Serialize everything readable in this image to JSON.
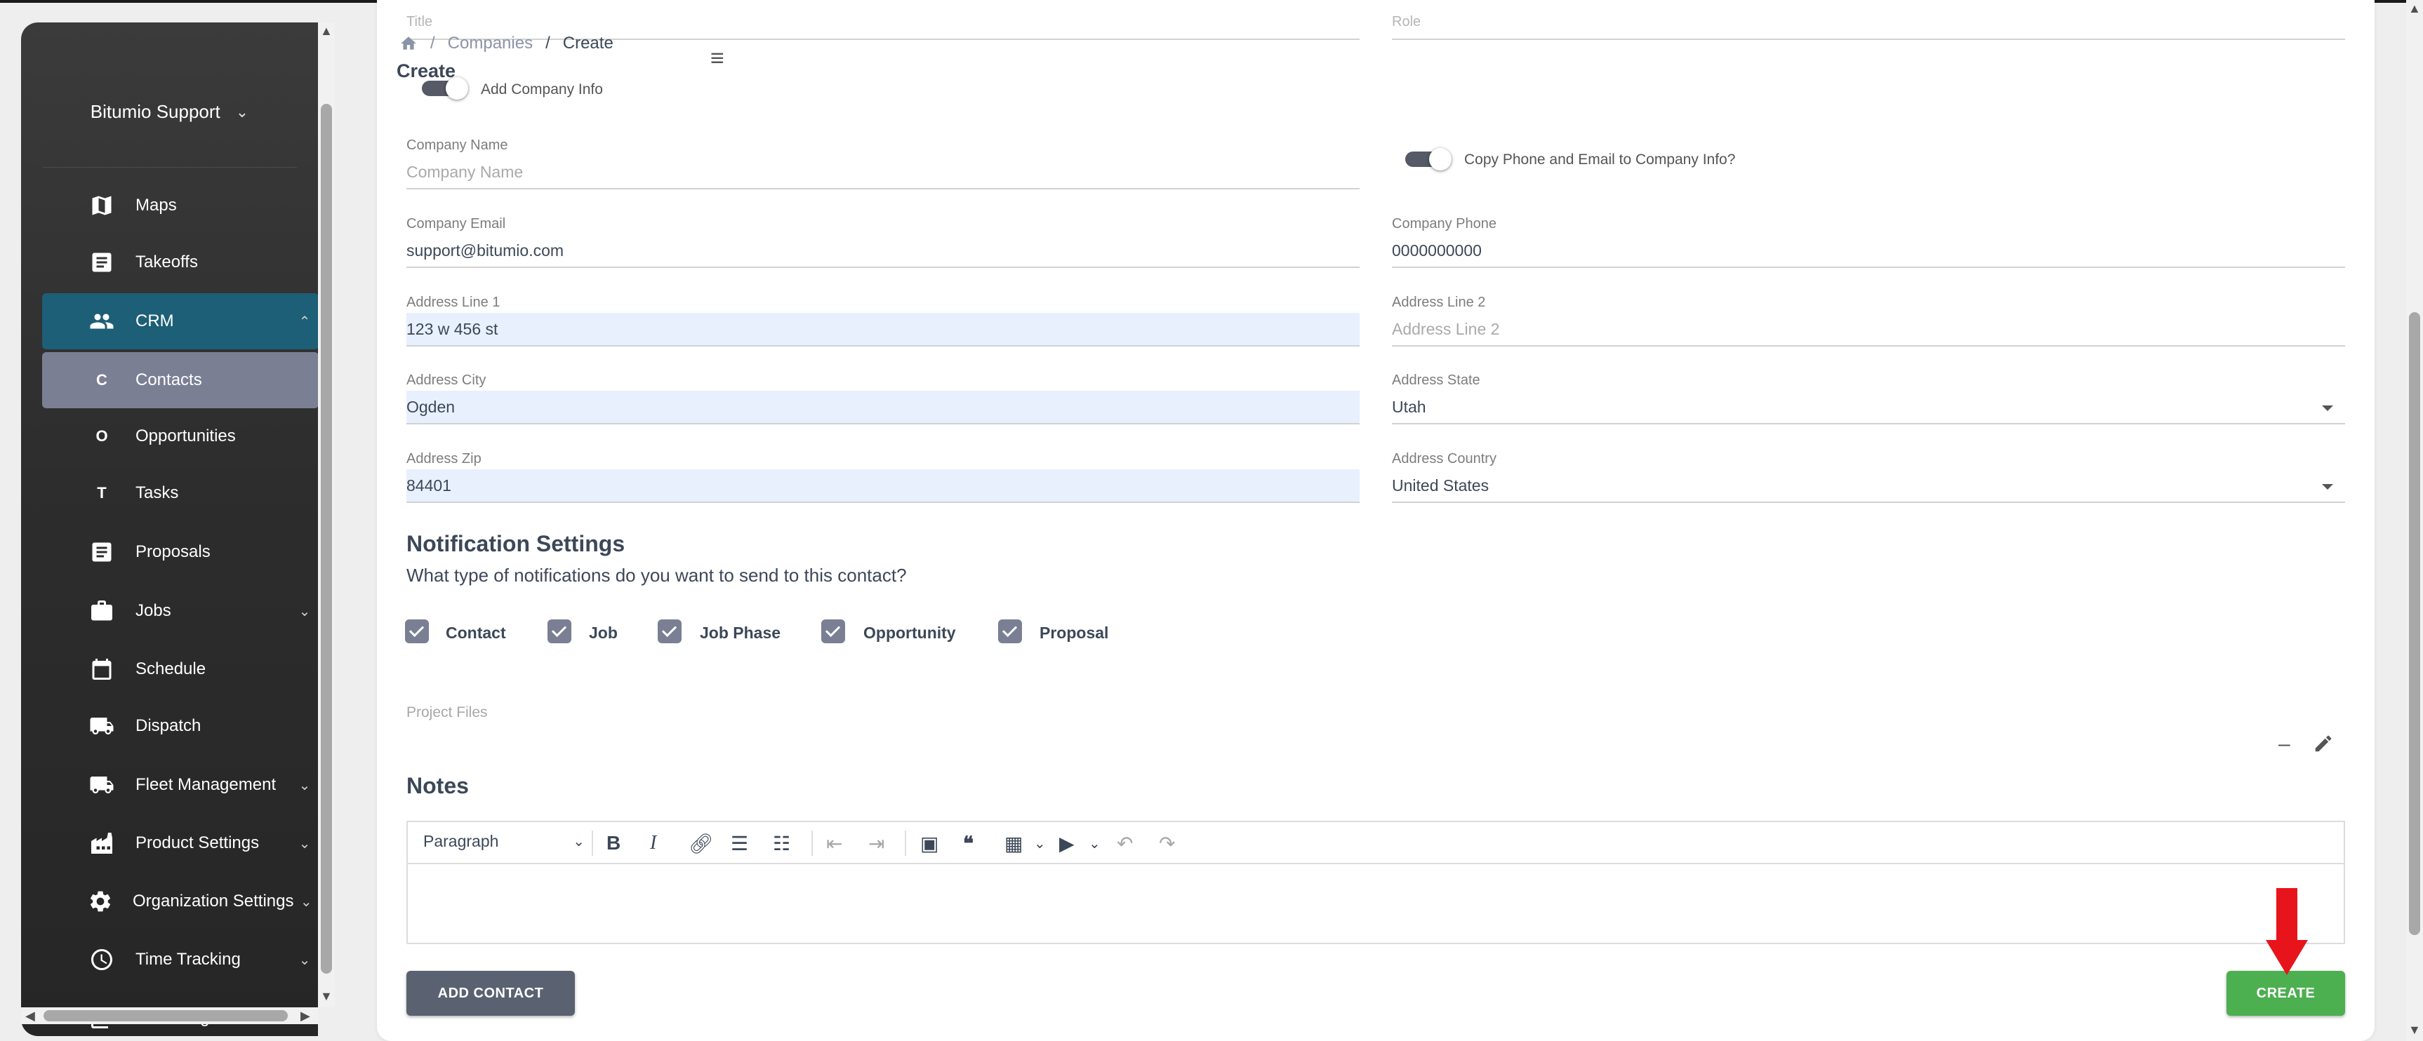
{
  "sidebar": {
    "org_name": "Bitumio Support",
    "items": [
      {
        "label": "Maps",
        "icon": "map-icon"
      },
      {
        "label": "Takeoffs",
        "icon": "document-icon"
      },
      {
        "label": "CRM",
        "icon": "people-icon",
        "expanded": true
      },
      {
        "label": "Contacts",
        "abbr": "C",
        "active": true
      },
      {
        "label": "Opportunities",
        "abbr": "O"
      },
      {
        "label": "Tasks",
        "abbr": "T"
      },
      {
        "label": "Proposals",
        "icon": "document-icon"
      },
      {
        "label": "Jobs",
        "icon": "briefcase-icon"
      },
      {
        "label": "Schedule",
        "icon": "calendar-icon"
      },
      {
        "label": "Dispatch",
        "icon": "truck-icon"
      },
      {
        "label": "Fleet Management",
        "icon": "truck-icon"
      },
      {
        "label": "Product Settings",
        "icon": "factory-icon"
      },
      {
        "label": "Organization Settings",
        "icon": "gear-icon"
      },
      {
        "label": "Time Tracking",
        "icon": "clock-icon"
      },
      {
        "label": "Knowledge Base",
        "icon": "book-icon"
      }
    ]
  },
  "header": {
    "breadcrumb_companies": "Companies",
    "breadcrumb_sep": "/",
    "breadcrumb_create": "Create",
    "page_title": "Create"
  },
  "form": {
    "title_label": "Title",
    "role_label": "Role",
    "add_company_info": "Add Company Info",
    "copy_phone_email": "Copy Phone and Email to Company Info?",
    "company_name_label": "Company Name",
    "company_name_placeholder": "Company Name",
    "company_email_label": "Company Email",
    "company_email_value": "support@bitumio.com",
    "company_phone_label": "Company Phone",
    "company_phone_value": "0000000000",
    "address1_label": "Address Line 1",
    "address1_value": "123 w 456 st",
    "address2_label": "Address Line 2",
    "address2_placeholder": "Address Line 2",
    "city_label": "Address City",
    "city_value": "Ogden",
    "state_label": "Address State",
    "state_value": "Utah",
    "zip_label": "Address Zip",
    "zip_value": "84401",
    "country_label": "Address Country",
    "country_value": "United States"
  },
  "notifications": {
    "title": "Notification Settings",
    "subtitle": "What type of notifications do you want to send to this contact?",
    "options": [
      {
        "label": "Contact",
        "checked": true
      },
      {
        "label": "Job",
        "checked": true
      },
      {
        "label": "Job Phase",
        "checked": true
      },
      {
        "label": "Opportunity",
        "checked": true
      },
      {
        "label": "Proposal",
        "checked": true
      }
    ]
  },
  "project_files_label": "Project Files",
  "notes": {
    "title": "Notes",
    "paragraph_select": "Paragraph"
  },
  "buttons": {
    "add_contact": "ADD CONTACT",
    "create": "CREATE"
  },
  "colors": {
    "crm_active": "#1d5f76",
    "contacts_active": "#7a7f94",
    "create_button": "#4caf50",
    "add_contact_button": "#5a6170",
    "annotation_arrow": "#e8141b"
  }
}
